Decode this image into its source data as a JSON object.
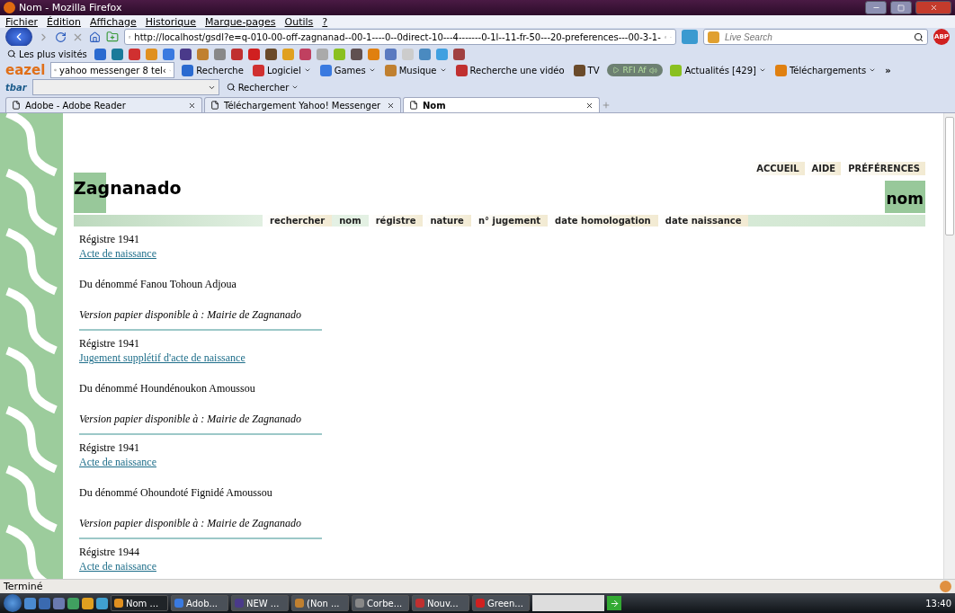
{
  "window": {
    "title": "Nom - Mozilla Firefox"
  },
  "menu": [
    "Fichier",
    "Édition",
    "Affichage",
    "Historique",
    "Marque-pages",
    "Outils",
    "?"
  ],
  "navbar": {
    "url": "http://localhost/gsdl?e=q-010-00-off-zagnanad--00-1----0--0direct-10---4-------0-1l--11-fr-50---20-preferences---00-3-1-",
    "search_placeholder": "Live Search",
    "adblock_label": "ABP"
  },
  "bookmarks": {
    "label": "Les plus visités"
  },
  "eazel_toolbar": {
    "logo": "eazel",
    "search_value": "yahoo messenger 8 tel‹",
    "items": [
      {
        "kind": "button",
        "label": "Recherche"
      },
      {
        "kind": "menu",
        "label": "Logiciel"
      },
      {
        "kind": "menu",
        "label": "Games"
      },
      {
        "kind": "menu",
        "label": "Musique"
      },
      {
        "kind": "button",
        "label": "Recherche une vidéo"
      },
      {
        "kind": "button",
        "label": "TV"
      },
      {
        "kind": "radio",
        "label": "RFI Af"
      },
      {
        "kind": "menu",
        "label": "Actualités [429]"
      },
      {
        "kind": "menu",
        "label": "Téléchargements"
      },
      {
        "kind": "more",
        "label": "»"
      }
    ]
  },
  "tbar": {
    "logo": "tbar",
    "search_label": "Rechercher"
  },
  "tabs": [
    {
      "label": "Adobe - Adobe Reader",
      "selected": false
    },
    {
      "label": "Téléchargement Yahoo! Messenger",
      "selected": false
    },
    {
      "label": "Nom",
      "selected": true
    }
  ],
  "page": {
    "site_title": "Zagnanado",
    "top_links": [
      "ACCUEIL",
      "AIDE",
      "PRÉFÉRENCES"
    ],
    "page_title": "nom",
    "nav": [
      {
        "label": "rechercher",
        "selected": false
      },
      {
        "label": "nom",
        "selected": true
      },
      {
        "label": "régistre",
        "selected": false
      },
      {
        "label": "nature",
        "selected": false
      },
      {
        "label": "n° jugement",
        "selected": false
      },
      {
        "label": "date homologation",
        "selected": false
      },
      {
        "label": "date naissance",
        "selected": false
      }
    ],
    "records": [
      {
        "register": "Régistre 1941",
        "link": "Acte de naissance",
        "person": "Du dénommé Fanou Tohoun Adjoua",
        "availability": "Version papier disponible à : Mairie de Zagnanado"
      },
      {
        "register": "Régistre 1941",
        "link": "Jugement supplétif d'acte de naissance",
        "person": "Du dénommé Houndénoukon Amoussou",
        "availability": "Version papier disponible à : Mairie de Zagnanado"
      },
      {
        "register": "Régistre 1941",
        "link": "Acte de naissance",
        "person": "Du dénommé Ohoundoté Fignidé Amoussou",
        "availability": "Version papier disponible à : Mairie de Zagnanado"
      },
      {
        "register": "Régistre 1944",
        "link": "Acte de naissance"
      }
    ]
  },
  "status_bar": {
    "text": "Terminé"
  },
  "taskbar": {
    "windows": [
      {
        "label": "Nom ...",
        "selected": true
      },
      {
        "label": "Adob...",
        "selected": false
      },
      {
        "label": "NEW ...",
        "selected": false
      },
      {
        "label": "(Non ...",
        "selected": false
      },
      {
        "label": "Corbe...",
        "selected": false
      },
      {
        "label": "Nouv...",
        "selected": false
      },
      {
        "label": "Green...",
        "selected": false
      }
    ],
    "clock": "13:40"
  }
}
